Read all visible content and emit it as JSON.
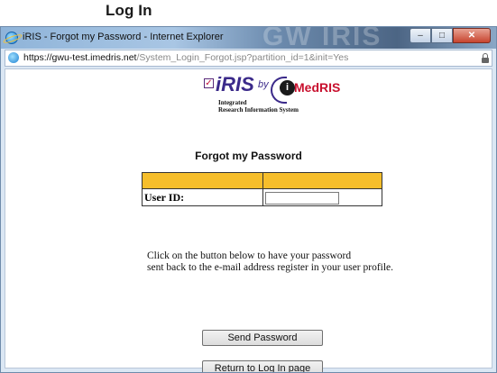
{
  "page": {
    "heading": "Log In"
  },
  "window": {
    "title": "iRIS - Forgot my Password - Internet Explorer",
    "background_ghost_text": "GW IRIS",
    "buttons": {
      "minimize": "–",
      "maximize": "□",
      "close": "✕"
    }
  },
  "address_bar": {
    "url_prefix": "https://gwu-test.",
    "url_domain": "imedris.net",
    "url_path": "/System_Login_Forgot.jsp?partition_id=1&init=Yes"
  },
  "logo": {
    "check_mark": "✓",
    "iris": "iRIS",
    "by": "by",
    "i_letter": "i",
    "brand": "MedRIS",
    "subtitle_line1": "Integrated",
    "subtitle_line2": "Research Information System"
  },
  "form": {
    "title": "Forgot my Password",
    "user_id_label": "User ID:",
    "user_id_value": "",
    "instruction_line1": "Click on the button below to have your password",
    "instruction_line2": "sent back to the e-mail address register in your user profile.",
    "send_button": "Send Password",
    "return_button": "Return to Log In page"
  },
  "colors": {
    "table_header": "#f6be2b",
    "brand_red": "#c8102e",
    "brand_purple": "#3b2a8a"
  }
}
